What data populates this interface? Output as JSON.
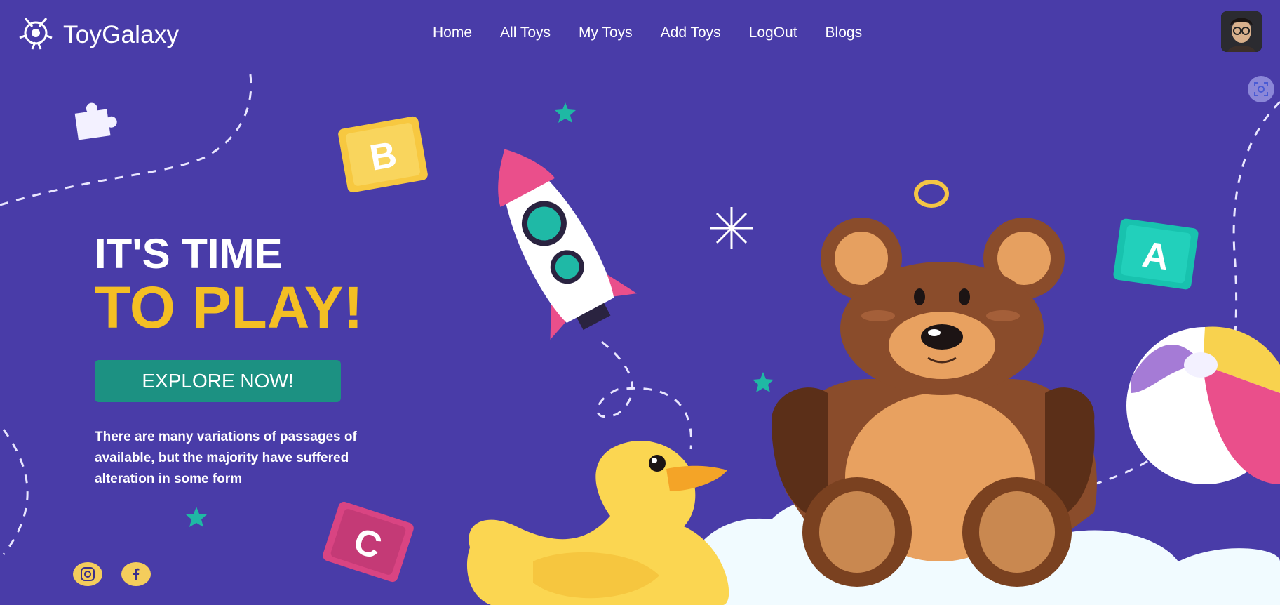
{
  "header": {
    "brand": "ToyGalaxy",
    "nav": [
      {
        "label": "Home"
      },
      {
        "label": "All Toys"
      },
      {
        "label": "My Toys"
      },
      {
        "label": "Add Toys"
      },
      {
        "label": "LogOut"
      },
      {
        "label": "Blogs"
      }
    ],
    "avatar_icon": "user-avatar"
  },
  "hero": {
    "headline_line1": "IT'S TIME",
    "headline_line2": "TO PLAY!",
    "cta_label": "EXPLORE NOW!",
    "description": "There are many variations of passages of available, but the majority have suffered alteration in some form"
  },
  "social": [
    {
      "icon": "instagram-icon"
    },
    {
      "icon": "facebook-icon"
    }
  ],
  "colors": {
    "background": "#493ca8",
    "accent_yellow": "#f4bf24",
    "button_teal": "#1c9182"
  },
  "decor_letters": [
    "B",
    "A",
    "C"
  ]
}
